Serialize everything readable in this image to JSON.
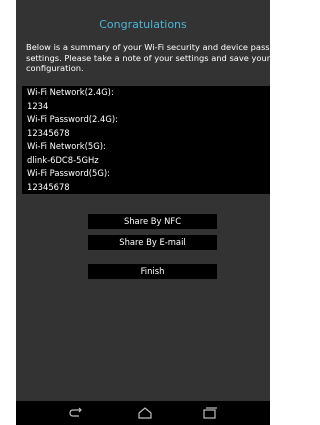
{
  "header": {
    "title": "Congratulations"
  },
  "summary_text": "Below is a summary of your Wi-Fi security and device password settings. Please take a note of your settings and save your configuration.",
  "credentials": [
    {
      "label": "Wi-Fi Network(2.4G):",
      "value": "1234"
    },
    {
      "label": "Wi-Fi Password(2.4G):",
      "value": "12345678"
    },
    {
      "label": "Wi-Fi Network(5G):",
      "value": "dlink-6DC8-5GHz"
    },
    {
      "label": "Wi-Fi Password(5G):",
      "value": "12345678"
    }
  ],
  "buttons": {
    "share_nfc": "Share By NFC",
    "share_email": "Share By E-mail",
    "finish": "Finish"
  },
  "nav": {
    "icons": [
      "back-icon",
      "home-icon",
      "recent-apps-icon"
    ]
  },
  "colors": {
    "accent": "#4bb3d6",
    "background": "#333333",
    "panel": "#000000"
  }
}
